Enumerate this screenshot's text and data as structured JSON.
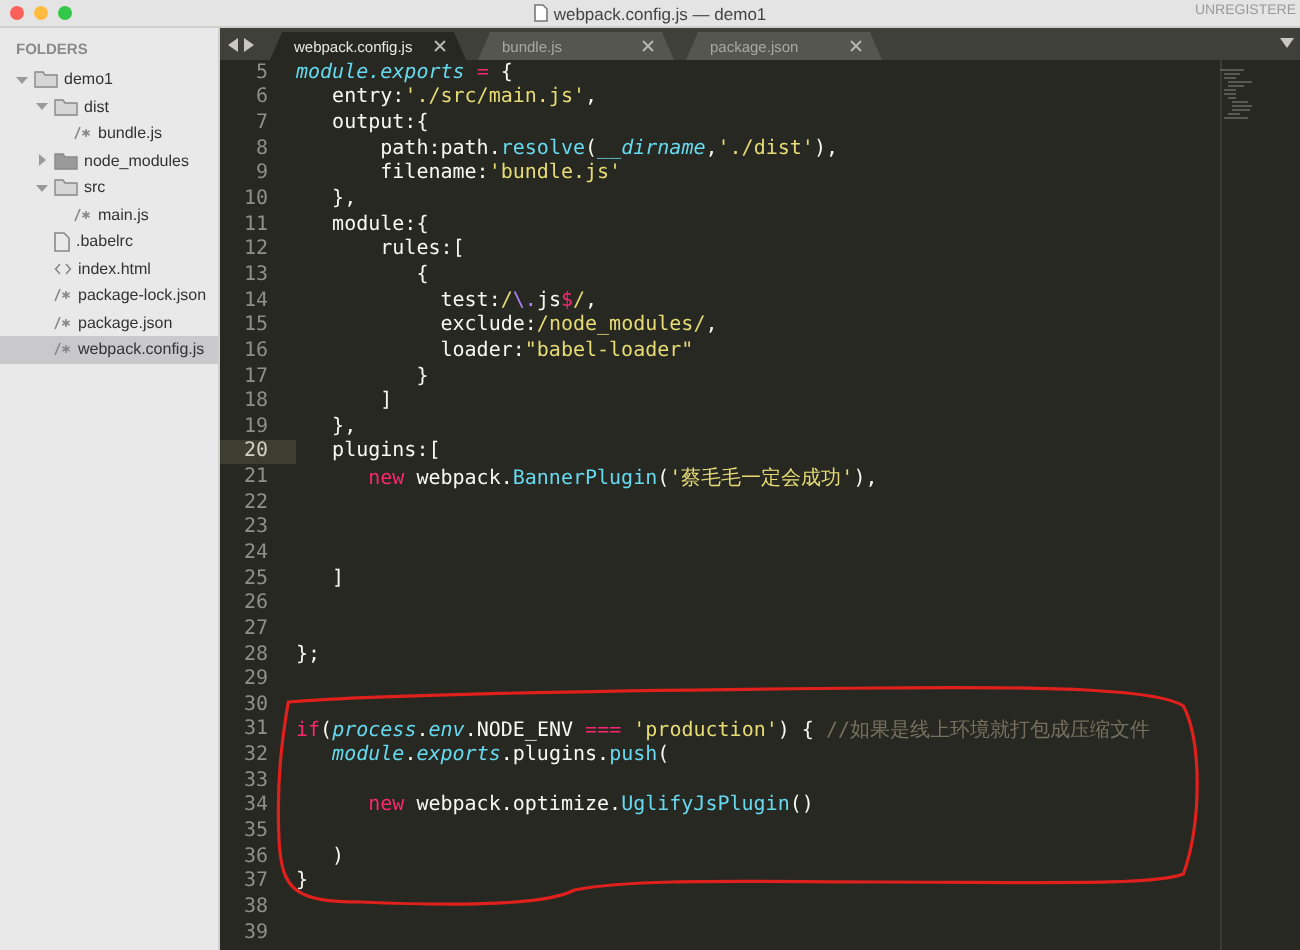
{
  "window": {
    "title": "webpack.config.js — demo1",
    "badge": "UNREGISTERE"
  },
  "sidebar": {
    "header": "FOLDERS",
    "items": [
      {
        "label": "demo1",
        "kind": "folder",
        "expanded": true,
        "selected": false,
        "children": [
          {
            "label": "dist",
            "kind": "folder",
            "expanded": true,
            "selected": false,
            "children": [
              {
                "label": "bundle.js",
                "kind": "script",
                "selected": false
              }
            ]
          },
          {
            "label": "node_modules",
            "kind": "folder",
            "expanded": false,
            "selected": false
          },
          {
            "label": "src",
            "kind": "folder",
            "expanded": true,
            "selected": false,
            "children": [
              {
                "label": "main.js",
                "kind": "script",
                "selected": false
              }
            ]
          },
          {
            "label": ".babelrc",
            "kind": "plain",
            "selected": false
          },
          {
            "label": "index.html",
            "kind": "markup",
            "selected": false
          },
          {
            "label": "package-lock.json",
            "kind": "script",
            "selected": false
          },
          {
            "label": "package.json",
            "kind": "script",
            "selected": false
          },
          {
            "label": "webpack.config.js",
            "kind": "script",
            "selected": true
          }
        ]
      }
    ]
  },
  "tabs": [
    {
      "label": "webpack.config.js",
      "selected": true
    },
    {
      "label": "bundle.js",
      "selected": false
    },
    {
      "label": "package.json",
      "selected": false
    }
  ],
  "editor": {
    "lines": [
      {
        "number": "5",
        "current": false,
        "tokens": [
          {
            "kind": "var",
            "text": "module.exports"
          },
          {
            "kind": "operator",
            "text": " ="
          },
          {
            "kind": "plain",
            "text": " {"
          }
        ]
      },
      {
        "number": "6",
        "current": false,
        "tokens": [
          {
            "kind": "plain",
            "text": "   entry:"
          },
          {
            "kind": "string",
            "text": "'./src/main.js'"
          },
          {
            "kind": "plain",
            "text": ","
          }
        ]
      },
      {
        "number": "7",
        "current": false,
        "tokens": [
          {
            "kind": "plain",
            "text": "   output:{"
          }
        ]
      },
      {
        "number": "8",
        "current": false,
        "tokens": [
          {
            "kind": "plain",
            "text": "       path:path."
          },
          {
            "kind": "call",
            "text": "resolve"
          },
          {
            "kind": "plain",
            "text": "("
          },
          {
            "kind": "var",
            "text": "__dirname"
          },
          {
            "kind": "plain",
            "text": ","
          },
          {
            "kind": "string",
            "text": "'./dist'"
          },
          {
            "kind": "plain",
            "text": "),"
          }
        ]
      },
      {
        "number": "9",
        "current": false,
        "tokens": [
          {
            "kind": "plain",
            "text": "       filename:"
          },
          {
            "kind": "string",
            "text": "'bundle.js'"
          }
        ]
      },
      {
        "number": "10",
        "current": false,
        "tokens": [
          {
            "kind": "plain",
            "text": "   },"
          }
        ]
      },
      {
        "number": "11",
        "current": false,
        "tokens": [
          {
            "kind": "plain",
            "text": "   module:{"
          }
        ]
      },
      {
        "number": "12",
        "current": false,
        "tokens": [
          {
            "kind": "plain",
            "text": "       rules:["
          }
        ]
      },
      {
        "number": "13",
        "current": false,
        "tokens": [
          {
            "kind": "plain",
            "text": "          {"
          }
        ]
      },
      {
        "number": "14",
        "current": false,
        "tokens": [
          {
            "kind": "plain",
            "text": "            test:"
          },
          {
            "kind": "string",
            "text": "/"
          },
          {
            "kind": "escape",
            "text": "\\."
          },
          {
            "kind": "plain",
            "text": "js"
          },
          {
            "kind": "operator",
            "text": "$"
          },
          {
            "kind": "string",
            "text": "/"
          },
          {
            "kind": "plain",
            "text": ","
          }
        ]
      },
      {
        "number": "15",
        "current": false,
        "tokens": [
          {
            "kind": "plain",
            "text": "            exclude:"
          },
          {
            "kind": "string",
            "text": "/node_modules/"
          },
          {
            "kind": "plain",
            "text": ","
          }
        ]
      },
      {
        "number": "16",
        "current": false,
        "tokens": [
          {
            "kind": "plain",
            "text": "            loader:"
          },
          {
            "kind": "string",
            "text": "\"babel-loader\""
          }
        ]
      },
      {
        "number": "17",
        "current": false,
        "tokens": [
          {
            "kind": "plain",
            "text": "          }"
          }
        ]
      },
      {
        "number": "18",
        "current": false,
        "tokens": [
          {
            "kind": "plain",
            "text": "       ]"
          }
        ]
      },
      {
        "number": "19",
        "current": false,
        "tokens": [
          {
            "kind": "plain",
            "text": "   },"
          }
        ]
      },
      {
        "number": "20",
        "current": true,
        "tokens": [
          {
            "kind": "plain",
            "text": "   plugins:["
          }
        ]
      },
      {
        "number": "21",
        "current": false,
        "tokens": [
          {
            "kind": "keyword",
            "text": "      new"
          },
          {
            "kind": "plain",
            "text": " webpack."
          },
          {
            "kind": "call",
            "text": "BannerPlugin"
          },
          {
            "kind": "plain",
            "text": "("
          },
          {
            "kind": "string",
            "text": "'蔡毛毛一定会成功'"
          },
          {
            "kind": "plain",
            "text": "),"
          }
        ]
      },
      {
        "number": "22",
        "current": false
      },
      {
        "number": "23",
        "current": false
      },
      {
        "number": "24",
        "current": false
      },
      {
        "number": "25",
        "current": false,
        "tokens": [
          {
            "kind": "plain",
            "text": "   ]"
          }
        ]
      },
      {
        "number": "26",
        "current": false
      },
      {
        "number": "27",
        "current": false
      },
      {
        "number": "28",
        "current": false,
        "tokens": [
          {
            "kind": "plain",
            "text": "};"
          }
        ]
      },
      {
        "number": "29",
        "current": false
      },
      {
        "number": "30",
        "current": false
      },
      {
        "number": "31",
        "current": false,
        "tokens": [
          {
            "kind": "keyword",
            "text": "if"
          },
          {
            "kind": "plain",
            "text": "("
          },
          {
            "kind": "var",
            "text": "process"
          },
          {
            "kind": "plain",
            "text": "."
          },
          {
            "kind": "var",
            "text": "env"
          },
          {
            "kind": "plain",
            "text": ".NODE_ENV "
          },
          {
            "kind": "operator",
            "text": "==="
          },
          {
            "kind": "string",
            "text": " 'production'"
          },
          {
            "kind": "plain",
            "text": ") { "
          },
          {
            "kind": "comment",
            "text": "//如果是线上环境就打包成压缩文件"
          }
        ]
      },
      {
        "number": "32",
        "current": false,
        "tokens": [
          {
            "kind": "var",
            "text": "   module"
          },
          {
            "kind": "plain",
            "text": "."
          },
          {
            "kind": "var",
            "text": "exports"
          },
          {
            "kind": "plain",
            "text": ".plugins."
          },
          {
            "kind": "call",
            "text": "push"
          },
          {
            "kind": "plain",
            "text": "("
          }
        ]
      },
      {
        "number": "33",
        "current": false
      },
      {
        "number": "34",
        "current": false,
        "tokens": [
          {
            "kind": "keyword",
            "text": "      new"
          },
          {
            "kind": "plain",
            "text": " webpack.optimize."
          },
          {
            "kind": "call",
            "text": "UglifyJsPlugin"
          },
          {
            "kind": "plain",
            "text": "()"
          }
        ]
      },
      {
        "number": "35",
        "current": false
      },
      {
        "number": "36",
        "current": false,
        "tokens": [
          {
            "kind": "plain",
            "text": "   )"
          }
        ]
      },
      {
        "number": "37",
        "current": false,
        "tokens": [
          {
            "kind": "plain",
            "text": "}"
          }
        ]
      },
      {
        "number": "38",
        "current": false
      },
      {
        "number": "39",
        "current": false
      }
    ]
  }
}
